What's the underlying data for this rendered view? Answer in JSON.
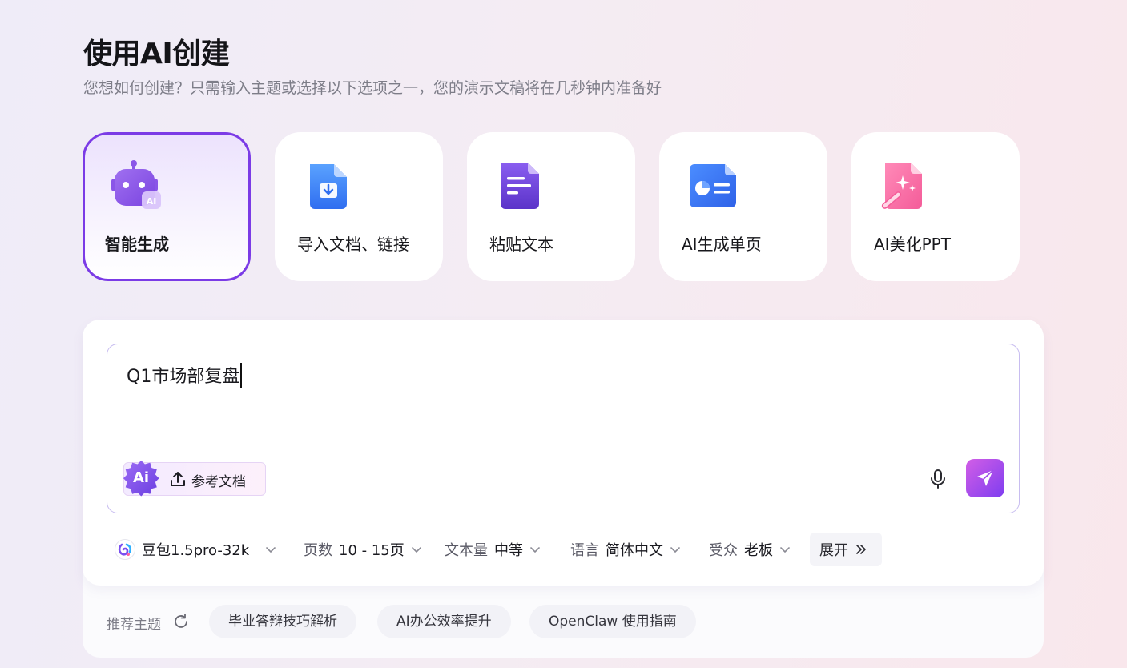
{
  "header": {
    "title": "使用AI创建",
    "subtitle": "您想如何创建？只需输入主题或选择以下选项之一，您的演示文稿将在几秒钟内准备好"
  },
  "modes": [
    {
      "label": "智能生成",
      "icon": "robot-ai-icon",
      "active": true
    },
    {
      "label": "导入文档、链接",
      "icon": "import-document-icon",
      "active": false
    },
    {
      "label": "粘贴文本",
      "icon": "paste-text-icon",
      "active": false
    },
    {
      "label": "AI生成单页",
      "icon": "single-slide-icon",
      "active": false
    },
    {
      "label": "AI美化PPT",
      "icon": "magic-beautify-icon",
      "active": false
    }
  ],
  "prompt": {
    "value": "Q1市场部复盘",
    "attach_badge": "Ai",
    "attach_label": "参考文档"
  },
  "options": {
    "model": "豆包1.5pro-32k",
    "pages_key": "页数",
    "pages_value": "10 - 15页",
    "text_key": "文本量",
    "text_value": "中等",
    "lang_key": "语言",
    "lang_value": "简体中文",
    "audience_key": "受众",
    "audience_value": "老板",
    "expand_label": "展开"
  },
  "recommend": {
    "label": "推荐主题",
    "topics": [
      "毕业答辩技巧解析",
      "AI办公效率提升",
      "OpenClaw 使用指南"
    ]
  },
  "colors": {
    "accent": "#7b3be6",
    "send_gradient_start": "#d25ee6",
    "send_gradient_end": "#7e3df0"
  }
}
